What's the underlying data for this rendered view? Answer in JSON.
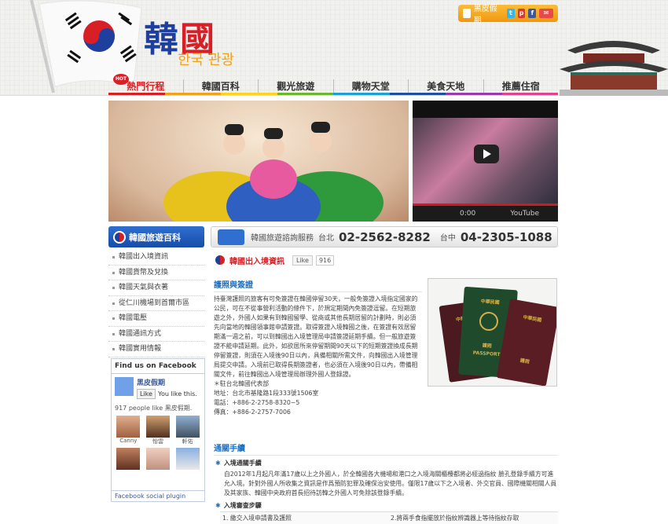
{
  "header": {
    "logo_main_1": "韓",
    "logo_main_2": "國",
    "logo_sub": "한국 관광",
    "top_button": "黑皮假期",
    "social_icons": [
      "twitter-icon",
      "plurk-icon",
      "facebook-icon",
      "email-icon"
    ]
  },
  "nav": {
    "hot_badge": "HOT",
    "items": [
      "熱門行程",
      "韓國百科",
      "觀光旅遊",
      "購物天堂",
      "美食天地",
      "推薦住宿"
    ]
  },
  "colorbar": [
    "#d81f26",
    "#f0a21c",
    "#ffd21f",
    "#6bb72e",
    "#1e9fd8",
    "#1e4fa8",
    "#9a3ab0",
    "#e0448c"
  ],
  "video": {
    "time": "0:00",
    "brand": "YouTube"
  },
  "sidebar": {
    "title": "韓國旅遊百科",
    "items": [
      "韓國出入境資訊",
      "韓國貨幣及兌換",
      "韓國天氣與衣著",
      "從仁川機場到首爾市區",
      "韓國電壓",
      "韓國通訊方式",
      "韓國實用情報"
    ]
  },
  "info_bar": {
    "label": "韓國旅遊諮詢服務",
    "city1": "台北",
    "phone1": "02-2562-8282",
    "city2": "台中",
    "phone2": "04-2305-1088"
  },
  "facebook": {
    "header": "Find us on Facebook",
    "page_name": "黑皮假期",
    "like": "Like",
    "you_like": "You like this.",
    "count": "917 people like 黑皮假期.",
    "faces": [
      "Canny",
      "怡雲",
      "軒佑",
      "",
      "",
      ""
    ],
    "footer": "Facebook social plugin"
  },
  "content": {
    "title": "韓國出入境資訊",
    "like": "Like",
    "like_count": "916",
    "section1": "護照與簽證",
    "body": [
      "持臺灣護照的旅客有可免簽證在韓國停留30天，一般免簽證入境指定國家的公民，可在不從事營利活動的條件下，於規定期間內免簽證逗留。在短期旅遊之外，外國人如果有到韓國留學、從商或其他長期居留的計劃時，則必須先向當地的韓國領事館申請簽證。取得簽證入境韓國之後，在簽證有效居留期滿一週之前，可以到韓國出入境管理局申請簽證延期手續。但一般旅遊簽證不能申請延期。此外，如欲居所來停留期間90天以下的短期簽證換成長期停留簽證，則須在入境後90日以內，具備相關所需文件，向韓國出入境管理局提交申請。入境前已取得長期簽證者，也必須在入境後90日以內，帶備相關文件，前往韓國出入境管理局辦理外國人登錄證。",
      "＊駐台北韓國代表部",
      "地址：台北市基隆路1段333號1506室",
      "電話：+886-2-2758-8320~5",
      "傳真：+886-2-2757-7006"
    ],
    "section2": "通關手續",
    "sub1": "入境通關手續",
    "p2": "自2012年1月起凡年滿17歲以上之外國人，於全韓國各大機場和港口之入境海關櫃檯都將必經過指紋 臉孔登錄手續方可進允入境。針對外國人所收集之資訊是作爲預防犯罪及確保治安使用。僅限17歲以下之入境者、外交官員、國際機關相關人員及其家族、韓國中央政府首長招待訪韓之外國人可免除該登錄手續。",
    "sub2": "入境審查步驟",
    "step1": "1. 繳交入境申請書及護照",
    "step2": "2.將兩手食指擺放於指紋辨識器上等待指紋存取"
  },
  "passport": {
    "republic": "中華民國",
    "passport": "PASSPORT",
    "label": "護照"
  }
}
